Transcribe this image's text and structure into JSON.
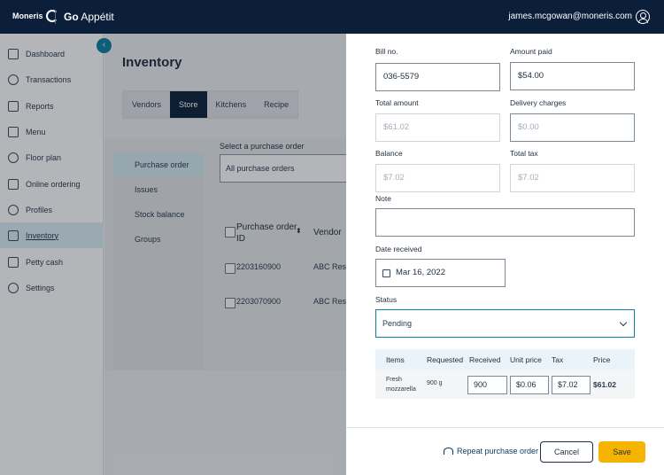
{
  "header": {
    "logo_text": "Moneris",
    "app_name_bold": "Go",
    "app_name_rest": " Appétit",
    "user_email": "james.mcgowan@moneris.com"
  },
  "sidebar": {
    "items": [
      {
        "label": "Dashboard",
        "icon": "dashboard-icon"
      },
      {
        "label": "Transactions",
        "icon": "transactions-icon"
      },
      {
        "label": "Reports",
        "icon": "reports-icon"
      },
      {
        "label": "Menu",
        "icon": "menu-icon"
      },
      {
        "label": "Floor plan",
        "icon": "floor-plan-icon"
      },
      {
        "label": "Online ordering",
        "icon": "online-ordering-icon"
      },
      {
        "label": "Profiles",
        "icon": "profiles-icon"
      },
      {
        "label": "Inventory",
        "icon": "inventory-icon"
      },
      {
        "label": "Petty cash",
        "icon": "petty-cash-icon"
      },
      {
        "label": "Settings",
        "icon": "settings-icon"
      }
    ],
    "active": "Inventory",
    "collapse_glyph": "‹"
  },
  "page": {
    "title": "Inventory",
    "tabs": [
      "Vendors",
      "Store",
      "Kitchens",
      "Recipe"
    ],
    "active_tab": "Store"
  },
  "subnav": {
    "items": [
      "Purchase order",
      "Issues",
      "Stock balance",
      "Groups"
    ],
    "active": "Purchase order"
  },
  "po_filter": {
    "label": "Select a purchase order",
    "value": "All purchase orders"
  },
  "po_table": {
    "headers": {
      "po_id": "Purchase order ID",
      "vendor": "Vendor"
    },
    "rows": [
      {
        "po_id": "2203160900",
        "vendor": "ABC Resta"
      },
      {
        "po_id": "2203070900",
        "vendor": "ABC Resta"
      }
    ]
  },
  "drawer": {
    "bill_no": {
      "label": "Bill no.",
      "value": "036-5579"
    },
    "amount_paid": {
      "label": "Amount paid",
      "value": "$54.00"
    },
    "total_amount": {
      "label": "Total amount",
      "value": "$61.02"
    },
    "delivery_charges": {
      "label": "Delivery charges",
      "value": "$0.00"
    },
    "balance": {
      "label": "Balance",
      "value": "$7.02"
    },
    "total_tax": {
      "label": "Total tax",
      "value": "$7.02"
    },
    "note": {
      "label": "Note",
      "value": ""
    },
    "date_received": {
      "label": "Date received",
      "value": "Mar 16, 2022"
    },
    "status": {
      "label": "Status",
      "value": "Pending"
    },
    "items": {
      "headers": [
        "Items",
        "Requested",
        "Received",
        "Unit price",
        "Tax",
        "Price"
      ],
      "rows": [
        {
          "item": "Fresh mozzarella",
          "requested": "900 g",
          "received": "900",
          "unit_price": "$0.06",
          "tax": "$7.02",
          "price": "$61.02"
        }
      ]
    }
  },
  "footer": {
    "repeat_label": "Repeat purchase order",
    "cancel_label": "Cancel",
    "save_label": "Save"
  },
  "colors": {
    "header_bg": "#0b1f3a",
    "accent": "#0a7fa3",
    "save": "#f5b400"
  }
}
